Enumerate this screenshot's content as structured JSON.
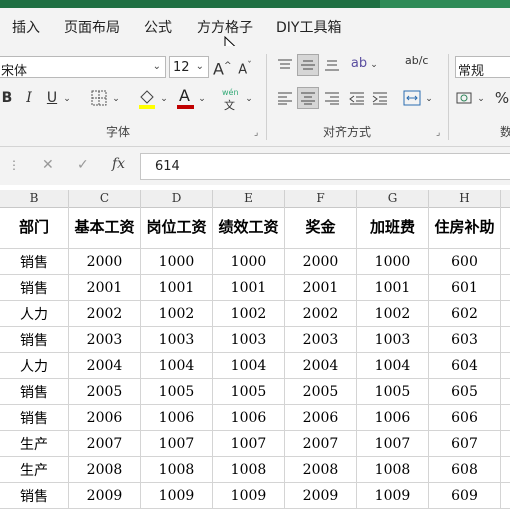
{
  "menu_tabs": [
    "插入",
    "页面布局",
    "公式",
    "方方格子",
    "DIY工具箱"
  ],
  "font": {
    "name": "宋体",
    "size": "12",
    "grow_label": "A",
    "shrink_label": "A"
  },
  "font_format": {
    "bold": "B",
    "italic": "I",
    "underline": "U",
    "font_color_letter": "A",
    "phonetic_label": "wén"
  },
  "alignment": {
    "wrap_label": "ab/c"
  },
  "number": {
    "format": "常规",
    "percent": "%"
  },
  "groups": {
    "font": "字体",
    "alignment": "对齐方式",
    "number": "数"
  },
  "formula_bar": {
    "cancel": "✕",
    "enter": "✓",
    "fx": "fx",
    "value": "614"
  },
  "columns": [
    "B",
    "C",
    "D",
    "E",
    "F",
    "G",
    "H"
  ],
  "table": {
    "headers": [
      "部门",
      "基本工资",
      "岗位工资",
      "绩效工资",
      "奖金",
      "加班费",
      "住房补助"
    ],
    "rows": [
      [
        "销售",
        "2000",
        "1000",
        "1000",
        "2000",
        "1000",
        "600"
      ],
      [
        "销售",
        "2001",
        "1001",
        "1001",
        "2001",
        "1001",
        "601"
      ],
      [
        "人力",
        "2002",
        "1002",
        "1002",
        "2002",
        "1002",
        "602"
      ],
      [
        "销售",
        "2003",
        "1003",
        "1003",
        "2003",
        "1003",
        "603"
      ],
      [
        "人力",
        "2004",
        "1004",
        "1004",
        "2004",
        "1004",
        "604"
      ],
      [
        "销售",
        "2005",
        "1005",
        "1005",
        "2005",
        "1005",
        "605"
      ],
      [
        "销售",
        "2006",
        "1006",
        "1006",
        "2006",
        "1006",
        "606"
      ],
      [
        "生产",
        "2007",
        "1007",
        "1007",
        "2007",
        "1007",
        "607"
      ],
      [
        "生产",
        "2008",
        "1008",
        "1008",
        "2008",
        "1008",
        "608"
      ],
      [
        "销售",
        "2009",
        "1009",
        "1009",
        "2009",
        "1009",
        "609"
      ]
    ]
  },
  "colors": {
    "title_green": "#1f6f43",
    "ribbon_bg": "#f3f3f3",
    "font_color_bar": "#c00000",
    "fill_color_bar": "#ffff00"
  }
}
